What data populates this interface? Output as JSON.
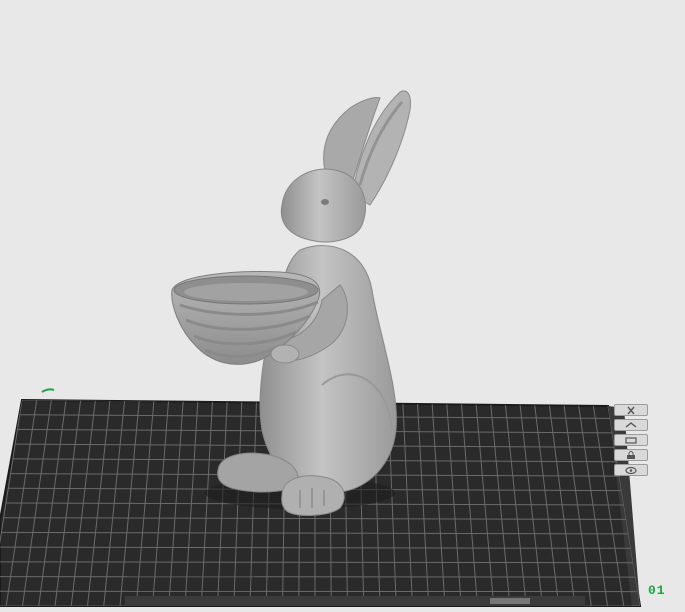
{
  "viewport": {
    "corner_label": "01",
    "bed_brand_text": "",
    "model_name": "bunny-with-basket"
  },
  "toolbar": {
    "buttons": [
      {
        "name": "close",
        "icon": "close-icon"
      },
      {
        "name": "move",
        "icon": "move-icon"
      },
      {
        "name": "align",
        "icon": "align-icon"
      },
      {
        "name": "lock",
        "icon": "lock-icon"
      },
      {
        "name": "view",
        "icon": "eye-icon"
      }
    ]
  },
  "colors": {
    "background": "#e8e8e8",
    "bed": "#2b2b2b",
    "grid": "#6b6b6b",
    "model": "#a8a8a8",
    "accent": "#1fa34a"
  }
}
